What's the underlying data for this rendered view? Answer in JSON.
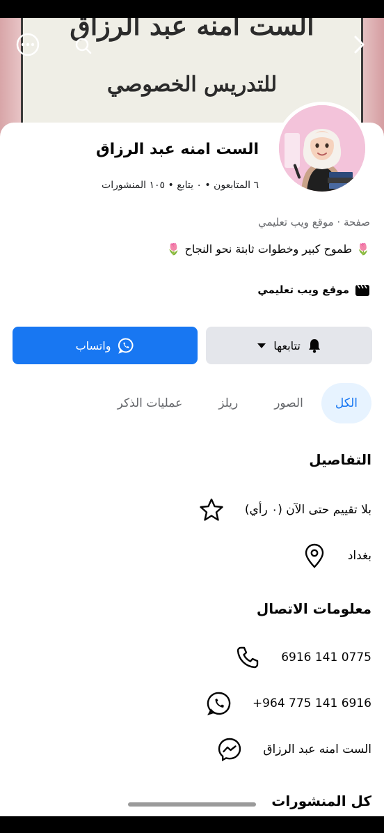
{
  "cover": {
    "line1": "الست امنه عبد الرزاق",
    "line2": "للتدريس الخصوصي"
  },
  "topbar": {
    "more_icon": "more-horizontal-icon",
    "search_icon": "search-icon",
    "back_icon": "chevron-right-icon"
  },
  "profile": {
    "name": "الست امنه عبد الرزاق",
    "stats": "٦ المتابعون • ٠ يتابع • ١٠٥ المنشورات",
    "category": "صفحة · موقع ويب تعليمي",
    "bio": "طموح كبير وخطوات ثابتة نحو النجاح",
    "bio_emoji": "🌷",
    "website_label": "موقع ويب تعليمي"
  },
  "actions": {
    "follow_label": "تتابعها",
    "whatsapp_label": "واتساب"
  },
  "tabs": [
    {
      "label": "الكل",
      "active": true
    },
    {
      "label": "الصور",
      "active": false
    },
    {
      "label": "ريلز",
      "active": false
    },
    {
      "label": "عمليات الذكر",
      "active": false
    }
  ],
  "details": {
    "title": "التفاصيل",
    "rating": "بلا تقييم حتى الآن (٠ رأي)",
    "location": "بغداد"
  },
  "contact": {
    "title": "معلومات الاتصال",
    "phone": "6916 141 0775",
    "whatsapp": "+964 775 141 6916",
    "messenger": "الست امنه عبد الرزاق"
  },
  "posts": {
    "title": "كل المنشورات"
  },
  "colors": {
    "primary": "#1877f2",
    "secondary_bg": "#e4e6eb",
    "active_tab_bg": "#e7f3ff",
    "muted_text": "#65676b"
  }
}
